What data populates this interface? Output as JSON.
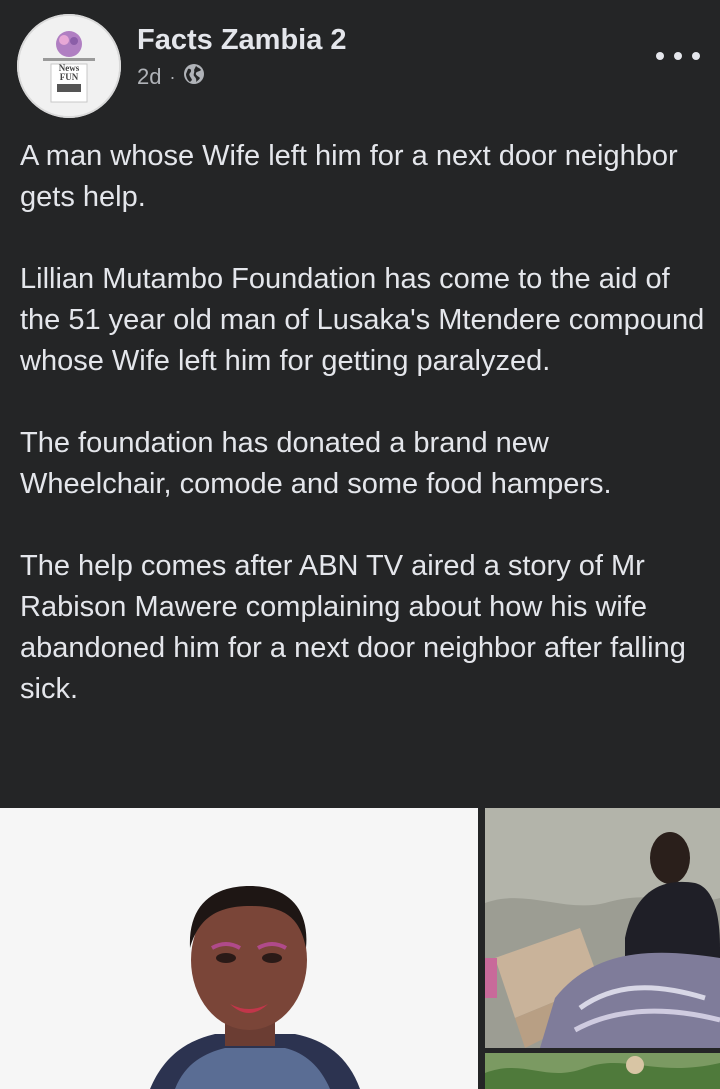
{
  "post": {
    "author": "Facts Zambia 2",
    "time": "2d",
    "separator": "·",
    "audience_icon": "globe-icon",
    "avatar_text": [
      "News",
      "FUN"
    ],
    "paragraphs": [
      "A man whose Wife left him for a next door neighbor gets help.",
      "Lillian Mutambo Foundation has come to the aid of the 51 year old man of Lusaka's Mtendere compound whose Wife left him for getting paralyzed.",
      "The foundation has donated a brand new Wheelchair, comode and some food hampers.",
      "The help comes after ABN TV aired a story of Mr Rabison Mawere complaining about how his wife abandoned him for a next door neighbor after falling sick."
    ]
  },
  "colors": {
    "background": "#242526",
    "primary_text": "#e4e6eb",
    "secondary_text": "#b0b3b8"
  }
}
